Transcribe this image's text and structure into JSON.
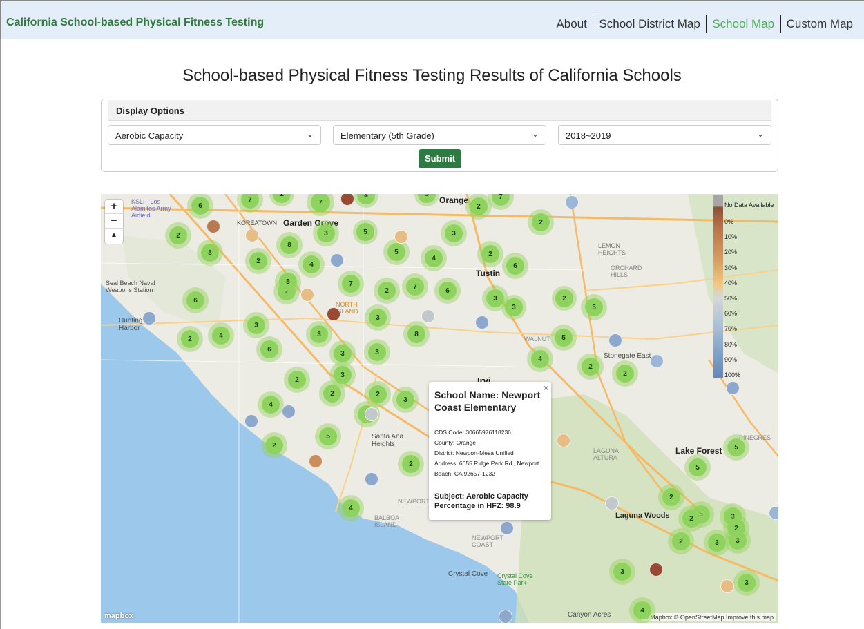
{
  "nav": {
    "brand": "California School-based Physical Fitness Testing",
    "items": [
      {
        "label": "About",
        "active": false
      },
      {
        "label": "School District Map",
        "active": false
      },
      {
        "label": "School Map",
        "active": true
      },
      {
        "label": "Custom Map",
        "active": false
      }
    ]
  },
  "page": {
    "title": "School-based Physical Fitness Testing Results of California Schools"
  },
  "options": {
    "header": "Display Options",
    "test_select": "Aerobic Capacity",
    "grade_select": "Elementary (5th Grade)",
    "year_select": "2018~2019",
    "submit_label": "Submit"
  },
  "map": {
    "zoom_in": "+",
    "zoom_out": "−",
    "compass": "▲",
    "attribution": "© Mapbox © OpenStreetMap  Improve this map",
    "logo": "mapbox",
    "labels": {
      "orange": "Orange",
      "garden_grove": "Garden Grove",
      "tustin": "Tustin",
      "irvine": "Irvi",
      "lake_forest": "Lake Forest",
      "laguna_woods": "Laguna Woods",
      "santa_ana_heights": "Santa Ana Heights",
      "north_island": "NORTH ISLAND",
      "huntington_harbor": "Huntington Harbor",
      "seal_beach": "Seal Beach Naval Weapons Station",
      "koreatown": "KOREATOWN",
      "orchard_hills": "ORCHARD HILLS",
      "lemon_heights": "LEMON HEIGHTS",
      "walnut": "WALNUT",
      "stonegate": "Stonegate East",
      "laguna_altura": "LAGUNA ALTURA",
      "newport_coast": "NEWPORT COAST",
      "balboa_island": "BALBOA ISLAND",
      "crystal_cove": "Crystal Cove",
      "crystal_cove_park": "Crystal Cove State Park",
      "canyon_acres": "Canyon Acres",
      "los_alamitos": "KSLI - Los Alamitos Army Airfield",
      "pinecrest": "PINECRES",
      "newport_center": "NEWPORT CENTE"
    }
  },
  "legend": {
    "labels": [
      "No Data Available",
      "0%",
      "10%",
      "20%",
      "30%",
      "40%",
      "50%",
      "60%",
      "70%",
      "80%",
      "90%",
      "100%"
    ]
  },
  "popup": {
    "school_name": "School Name: Newport Coast Elementary",
    "cds_code": "CDS Code: 30665976118236",
    "county": "County: Orange",
    "district": "District: Newport-Mesa Unified",
    "address": "Address: 6655 Ridge Park Rd., Newport Beach, CA 92657-1232",
    "subject": "Subject: Aerobic Capacity",
    "percentage": "Percentage in HFZ: 98.9",
    "close": "×"
  },
  "clusters": [
    {
      "n": "6"
    },
    {
      "n": "7"
    },
    {
      "n": "2"
    },
    {
      "n": "7"
    },
    {
      "n": "4"
    },
    {
      "n": "3"
    },
    {
      "n": "2"
    },
    {
      "n": "7"
    },
    {
      "n": "2"
    },
    {
      "n": "2"
    },
    {
      "n": "3"
    },
    {
      "n": "5"
    },
    {
      "n": "3"
    },
    {
      "n": "8"
    },
    {
      "n": "8"
    },
    {
      "n": "2"
    },
    {
      "n": "5"
    },
    {
      "n": "4"
    },
    {
      "n": "2"
    },
    {
      "n": "6"
    },
    {
      "n": "4"
    },
    {
      "n": "2"
    },
    {
      "n": "5"
    },
    {
      "n": "7"
    },
    {
      "n": "2"
    },
    {
      "n": "7"
    },
    {
      "n": "6"
    },
    {
      "n": "3"
    },
    {
      "n": "3"
    },
    {
      "n": "2"
    },
    {
      "n": "5"
    },
    {
      "n": "6"
    },
    {
      "n": "3"
    },
    {
      "n": "8"
    },
    {
      "n": "4"
    },
    {
      "n": "3"
    },
    {
      "n": "3"
    },
    {
      "n": "6"
    },
    {
      "n": "2"
    },
    {
      "n": "3"
    },
    {
      "n": "3"
    },
    {
      "n": "5"
    },
    {
      "n": "4"
    },
    {
      "n": "2"
    },
    {
      "n": "2"
    },
    {
      "n": "2"
    },
    {
      "n": "3"
    },
    {
      "n": "2"
    },
    {
      "n": "2"
    },
    {
      "n": "3"
    },
    {
      "n": "4"
    },
    {
      "n": "3"
    },
    {
      "n": "5"
    },
    {
      "n": "2"
    },
    {
      "n": "2"
    },
    {
      "n": "4"
    },
    {
      "n": "3"
    },
    {
      "n": "5"
    },
    {
      "n": "2"
    },
    {
      "n": "5"
    },
    {
      "n": "3"
    },
    {
      "n": "2"
    },
    {
      "n": "3"
    },
    {
      "n": "2"
    },
    {
      "n": "3"
    },
    {
      "n": "3"
    },
    {
      "n": "4"
    },
    {
      "n": "5"
    },
    {
      "n": "2"
    }
  ],
  "colors": {
    "brand": "#2f7a3c",
    "active_nav": "#4caf50",
    "submit": "#2f7a43",
    "cluster": "#8fd35f"
  }
}
